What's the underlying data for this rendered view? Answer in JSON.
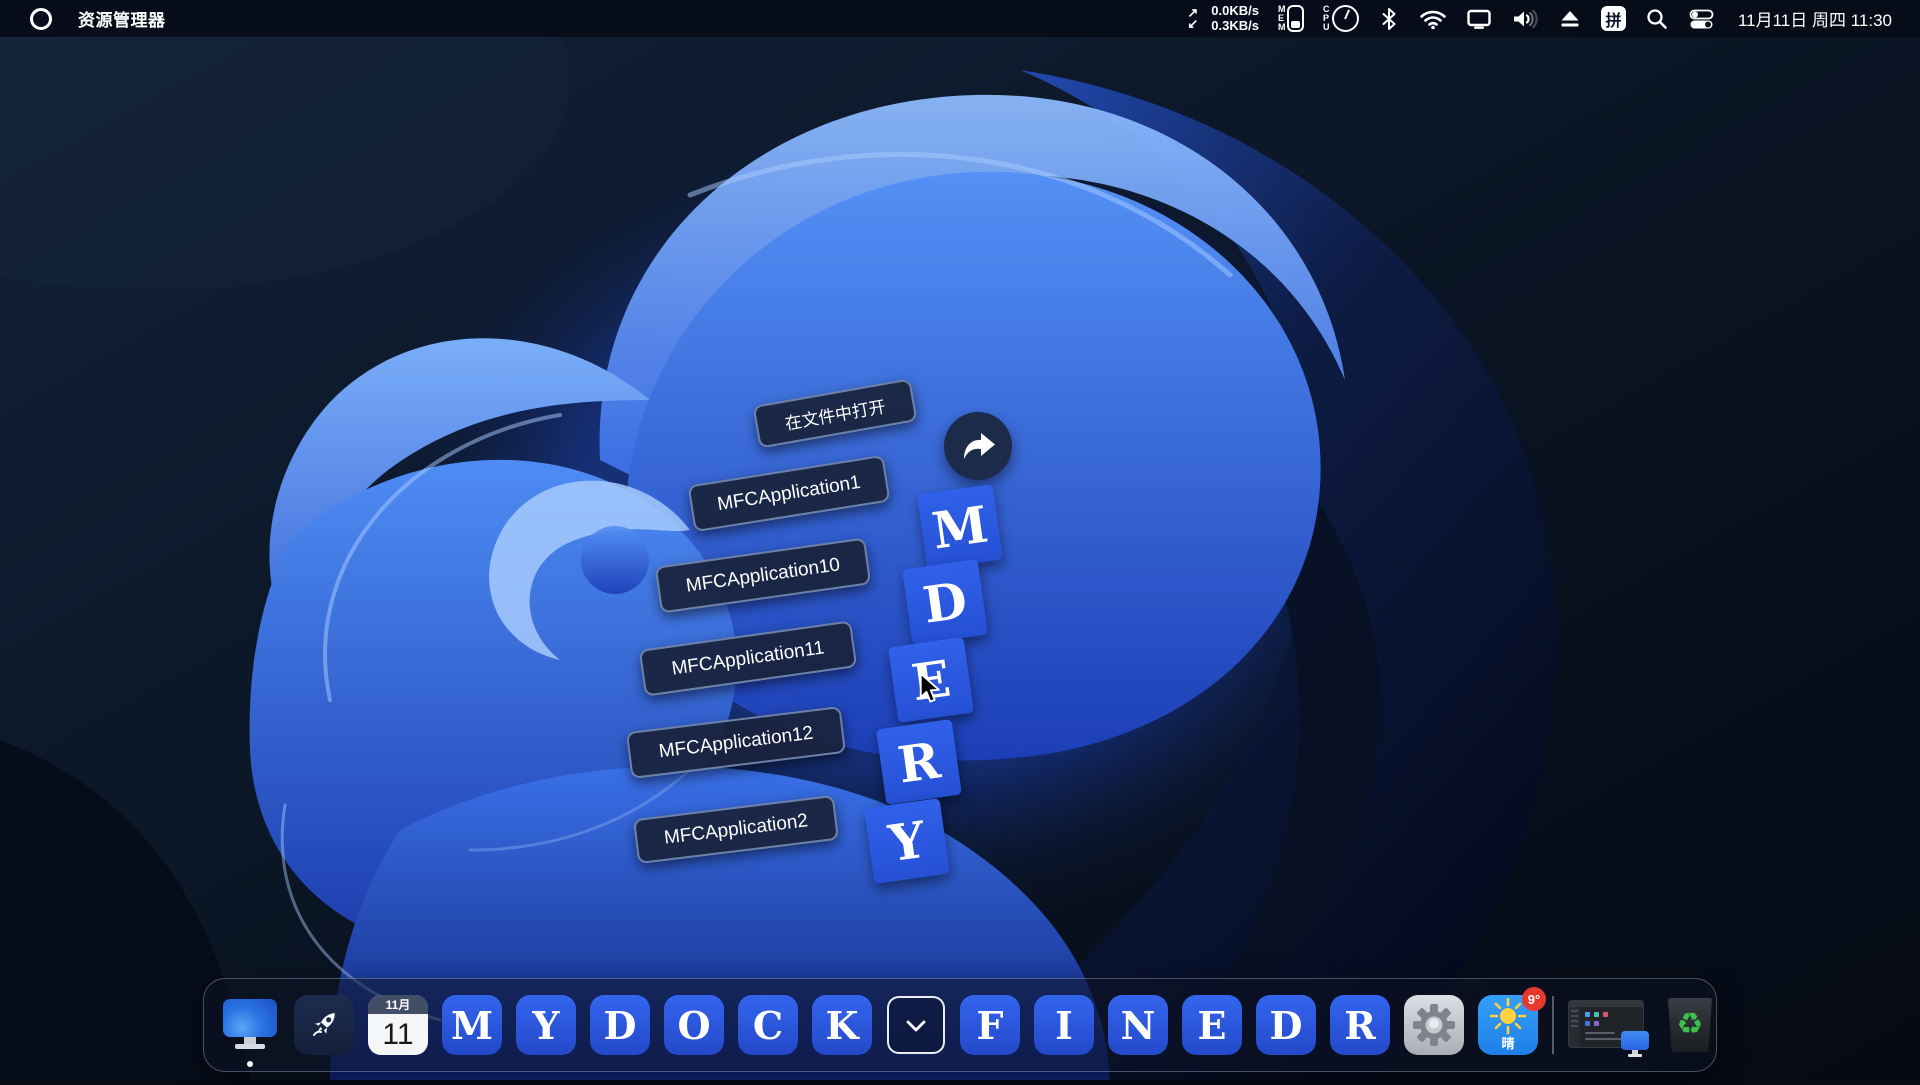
{
  "menu_bar": {
    "app_title": "资源管理器",
    "net_up_glyph": "↗",
    "net_down_glyph": "↙",
    "net_up": "0.0KB/s",
    "net_down": "0.3KB/s",
    "mem_label": "MEM",
    "cpu_label": "CPU",
    "input_method_label": "拼",
    "datetime": "11月11日 周四 11:30"
  },
  "stack": {
    "open_with_label": "在文件中打开",
    "items": [
      {
        "label": "MFCApplication1",
        "letter": "M"
      },
      {
        "label": "MFCApplication10",
        "letter": "D"
      },
      {
        "label": "MFCApplication11",
        "letter": "E"
      },
      {
        "label": "MFCApplication12",
        "letter": "R"
      },
      {
        "label": "MFCApplication2",
        "letter": "Y"
      }
    ]
  },
  "dock": {
    "calendar": {
      "month": "11月",
      "day": "11"
    },
    "letters_left": [
      "M",
      "Y",
      "D",
      "O",
      "C",
      "K"
    ],
    "letters_right": [
      "F",
      "I",
      "N",
      "E",
      "D",
      "R"
    ],
    "weather": {
      "badge": "9°",
      "condition": "晴"
    },
    "recycle_glyph": "♻"
  },
  "colors": {
    "accent_blue": "#2b5ce4",
    "menubar_bg": "#060c18",
    "tooltip_bg": "#19233e",
    "badge_red": "#e8392f",
    "recycle_green": "#3ec24e"
  }
}
